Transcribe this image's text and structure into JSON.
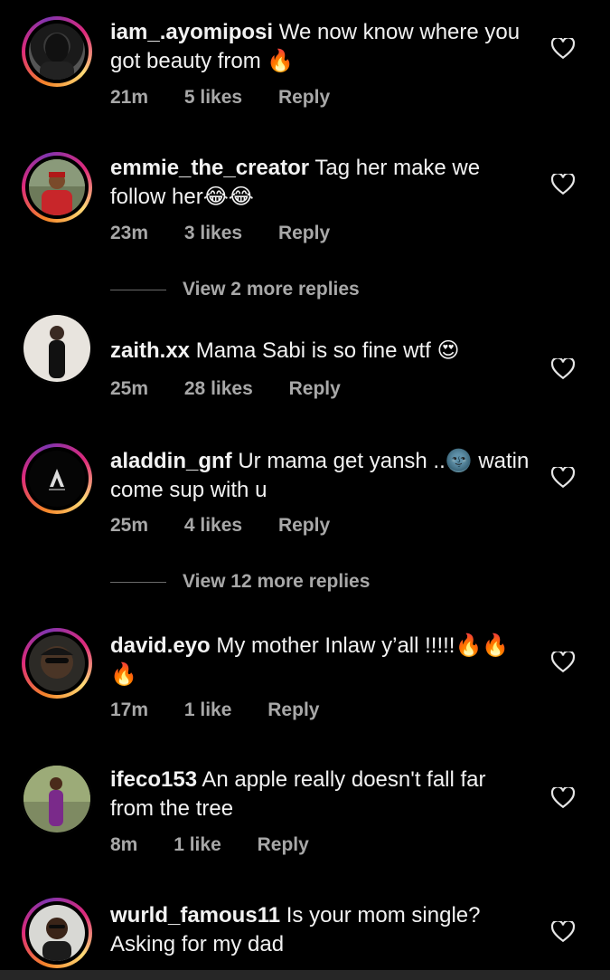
{
  "comments": [
    {
      "username": "iam_.ayomiposi",
      "text": "We now know where you got beauty from 🔥",
      "time": "21m",
      "likes": "5 likes",
      "reply": "Reply"
    },
    {
      "username": "emmie_the_creator",
      "text": "Tag her make we follow her😂😂",
      "time": "23m",
      "likes": "3 likes",
      "reply": "Reply"
    },
    {
      "username": "zaith.xx",
      "text": "Mama Sabi is so fine wtf 😍",
      "time": "25m",
      "likes": "28 likes",
      "reply": "Reply"
    },
    {
      "username": "aladdin_gnf",
      "text": "Ur mama get yansh ..🌚 watin come sup with u",
      "time": "25m",
      "likes": "4 likes",
      "reply": "Reply"
    },
    {
      "username": "david.eyo",
      "text": "My mother Inlaw y’all !!!!!🔥🔥🔥",
      "time": "17m",
      "likes": "1 like",
      "reply": "Reply"
    },
    {
      "username": "ifeco153",
      "text": "An apple really doesn't fall far from the tree",
      "time": "8m",
      "likes": "1 like",
      "reply": "Reply"
    },
    {
      "username": "wurld_famous11",
      "text": "Is your mom single? Asking for my dad"
    }
  ],
  "view_more": [
    {
      "label": "View 2 more replies"
    },
    {
      "label": "View 12 more replies"
    }
  ],
  "icons": {
    "like": "heart-outline-icon"
  },
  "colors": {
    "background": "#000000",
    "meta": "#a8a8a8",
    "story_ring": "#dd2a7b"
  }
}
